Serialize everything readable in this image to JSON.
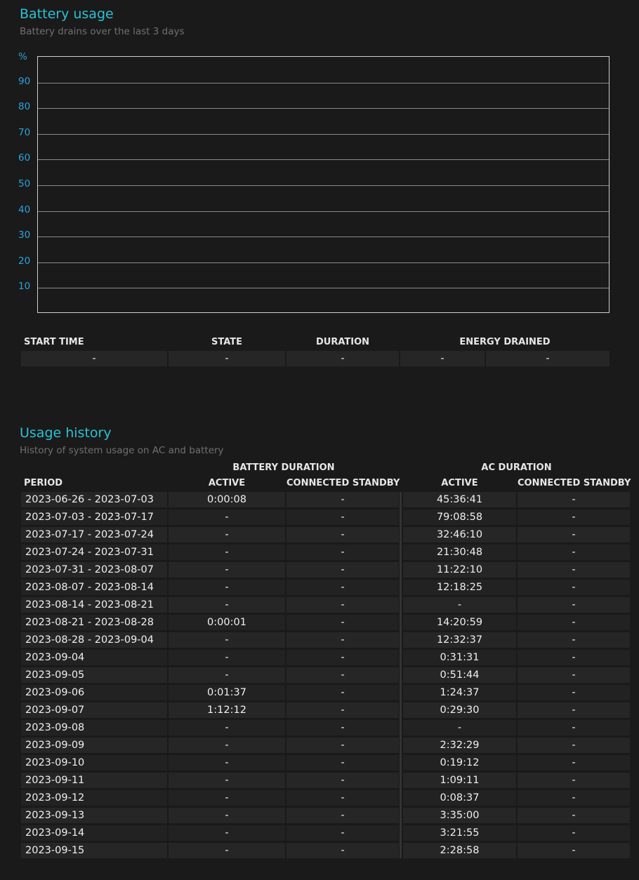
{
  "battery_usage": {
    "title": "Battery usage",
    "subtitle": "Battery drains over the last 3 days",
    "chart_data": {
      "type": "line",
      "title": "",
      "ylabel": "%",
      "ylim": [
        0,
        100
      ],
      "y_ticks": [
        "90",
        "80",
        "70",
        "60",
        "50",
        "40",
        "30",
        "20",
        "10"
      ],
      "series": [],
      "grid": true
    },
    "table": {
      "headers": {
        "start_time": "START TIME",
        "state": "STATE",
        "duration": "DURATION",
        "energy_drained": "ENERGY DRAINED"
      },
      "row": [
        "-",
        "-",
        "-",
        "-",
        "-"
      ]
    }
  },
  "usage_history": {
    "title": "Usage history",
    "subtitle": "History of system usage on AC and battery",
    "group_headers": {
      "battery": "BATTERY DURATION",
      "ac": "AC DURATION"
    },
    "headers": {
      "period": "PERIOD",
      "battery_active": "ACTIVE",
      "battery_standby": "CONNECTED STANDBY",
      "ac_active": "ACTIVE",
      "ac_standby": "CONNECTED STANDBY"
    },
    "rows": [
      [
        "2023-06-26 - 2023-07-03",
        "0:00:08",
        "-",
        "45:36:41",
        "-"
      ],
      [
        "2023-07-03 - 2023-07-17",
        "-",
        "-",
        "79:08:58",
        "-"
      ],
      [
        "2023-07-17 - 2023-07-24",
        "-",
        "-",
        "32:46:10",
        "-"
      ],
      [
        "2023-07-24 - 2023-07-31",
        "-",
        "-",
        "21:30:48",
        "-"
      ],
      [
        "2023-07-31 - 2023-08-07",
        "-",
        "-",
        "11:22:10",
        "-"
      ],
      [
        "2023-08-07 - 2023-08-14",
        "-",
        "-",
        "12:18:25",
        "-"
      ],
      [
        "2023-08-14 - 2023-08-21",
        "-",
        "-",
        "-",
        "-"
      ],
      [
        "2023-08-21 - 2023-08-28",
        "0:00:01",
        "-",
        "14:20:59",
        "-"
      ],
      [
        "2023-08-28 - 2023-09-04",
        "-",
        "-",
        "12:32:37",
        "-"
      ],
      [
        "2023-09-04",
        "-",
        "-",
        "0:31:31",
        "-"
      ],
      [
        "2023-09-05",
        "-",
        "-",
        "0:51:44",
        "-"
      ],
      [
        "2023-09-06",
        "0:01:37",
        "-",
        "1:24:37",
        "-"
      ],
      [
        "2023-09-07",
        "1:12:12",
        "-",
        "0:29:30",
        "-"
      ],
      [
        "2023-09-08",
        "-",
        "-",
        "-",
        "-"
      ],
      [
        "2023-09-09",
        "-",
        "-",
        "2:32:29",
        "-"
      ],
      [
        "2023-09-10",
        "-",
        "-",
        "0:19:12",
        "-"
      ],
      [
        "2023-09-11",
        "-",
        "-",
        "1:09:11",
        "-"
      ],
      [
        "2023-09-12",
        "-",
        "-",
        "0:08:37",
        "-"
      ],
      [
        "2023-09-13",
        "-",
        "-",
        "3:35:00",
        "-"
      ],
      [
        "2023-09-14",
        "-",
        "-",
        "3:21:55",
        "-"
      ],
      [
        "2023-09-15",
        "-",
        "-",
        "2:28:58",
        "-"
      ]
    ]
  }
}
